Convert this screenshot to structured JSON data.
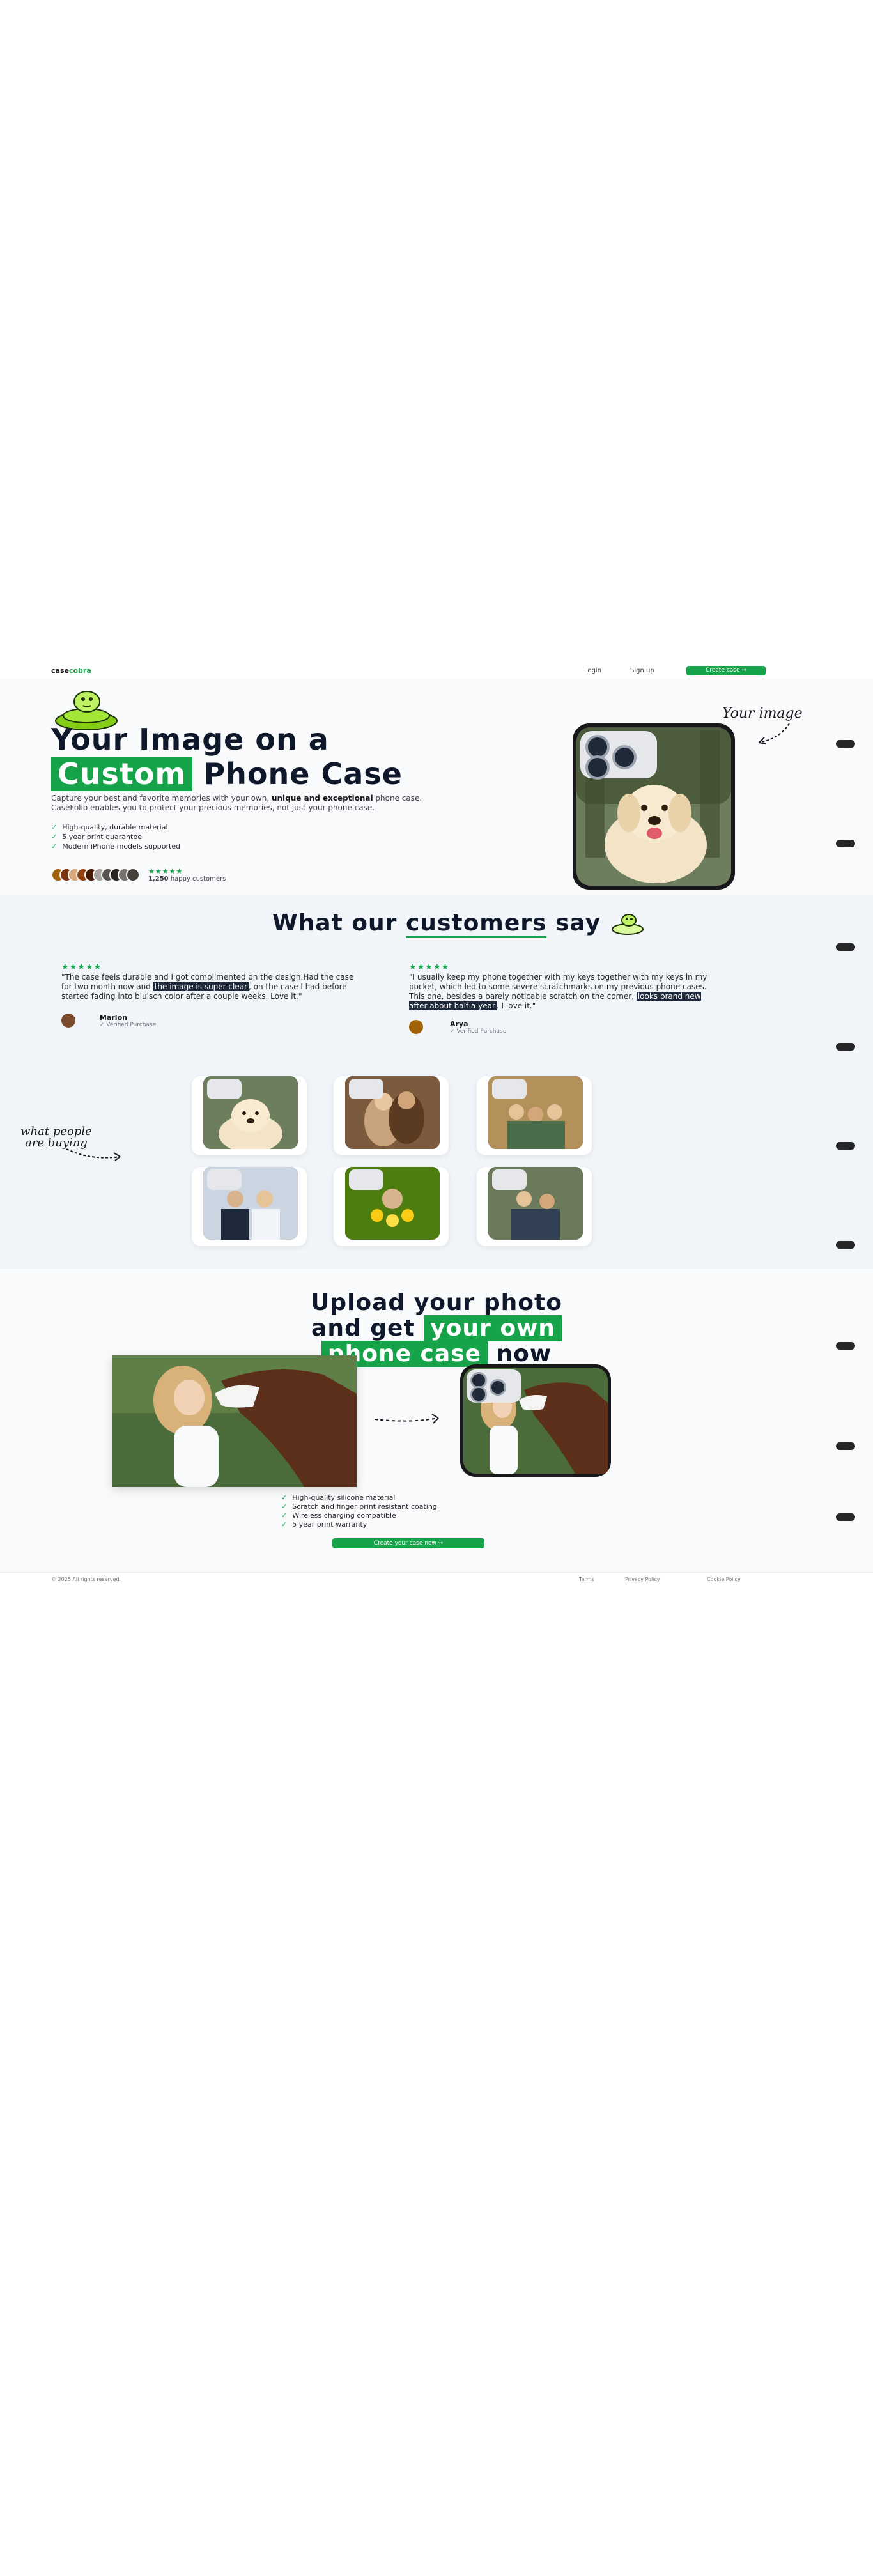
{
  "nav": {
    "logo_prefix": "case",
    "logo_accent": "cobra",
    "login": "Login",
    "signup": "Sign up",
    "create_case": "Create case →"
  },
  "hero": {
    "title_line1": "Your Image on a",
    "title_highlight": "Custom",
    "title_rest": " Phone Case",
    "paragraph_start": "Capture your best and favorite memories with your own, ",
    "paragraph_bold": "unique and exceptional",
    "paragraph_end": " phone case. CaseFolio enables you to protect your precious memories, not just your phone case.",
    "checks": [
      "High-quality, durable material",
      "5 year print guarantee",
      "Modern iPhone models supported"
    ],
    "stars": "★★★★★",
    "happy_count": "1,250",
    "happy_label": " happy customers",
    "your_image_label": "Your image"
  },
  "reviews": {
    "title_start": "What our ",
    "title_highlight": "customers",
    "title_end": " say",
    "items": [
      {
        "stars": "★★★★★",
        "quote_start": "\"The case feels durable and I got complimented on the design.Had the case for two month now and ",
        "quote_mark": "the image is super clear",
        "quote_end": ", on the case I had before started fading into bluisch color after a couple weeks. Love it.\"",
        "name": "Marlon",
        "verified": "✓ Verified Purchase"
      },
      {
        "stars": "★★★★★",
        "quote_start": "\"I usually keep my phone together with my keys together with my keys in my pocket, which led to some severe scratchmarks on my previous phone cases. This one, besides a barely noticable scratch on the corner, ",
        "quote_mark": "looks brand new after about half a year",
        "quote_end": ". I love it.\"",
        "name": "Arya",
        "verified": "✓ Verified Purchase"
      }
    ],
    "what_people_label": "what people are buying"
  },
  "upload": {
    "title_line1": "Upload your photo",
    "title_line2_start": "and get ",
    "title_line2_highlight": "your own",
    "title_line3_highlight": "phone case",
    "title_line3_end": " now",
    "checks": [
      "High-quality silicone material",
      "Scratch and finger print resistant coating",
      "Wireless charging compatible",
      "5 year print warranty"
    ],
    "button": "Create your case now →"
  },
  "footer": {
    "copyright": "© 2025 All rights reserved",
    "terms": "Terms",
    "privacy": "Privacy Policy",
    "cookie": "Cookie Policy"
  },
  "colors": {
    "accent": "#16a34a",
    "dark": "#0f172a",
    "hero_bg": "#f8fafc",
    "reviews_bg": "#f1f5f9"
  }
}
